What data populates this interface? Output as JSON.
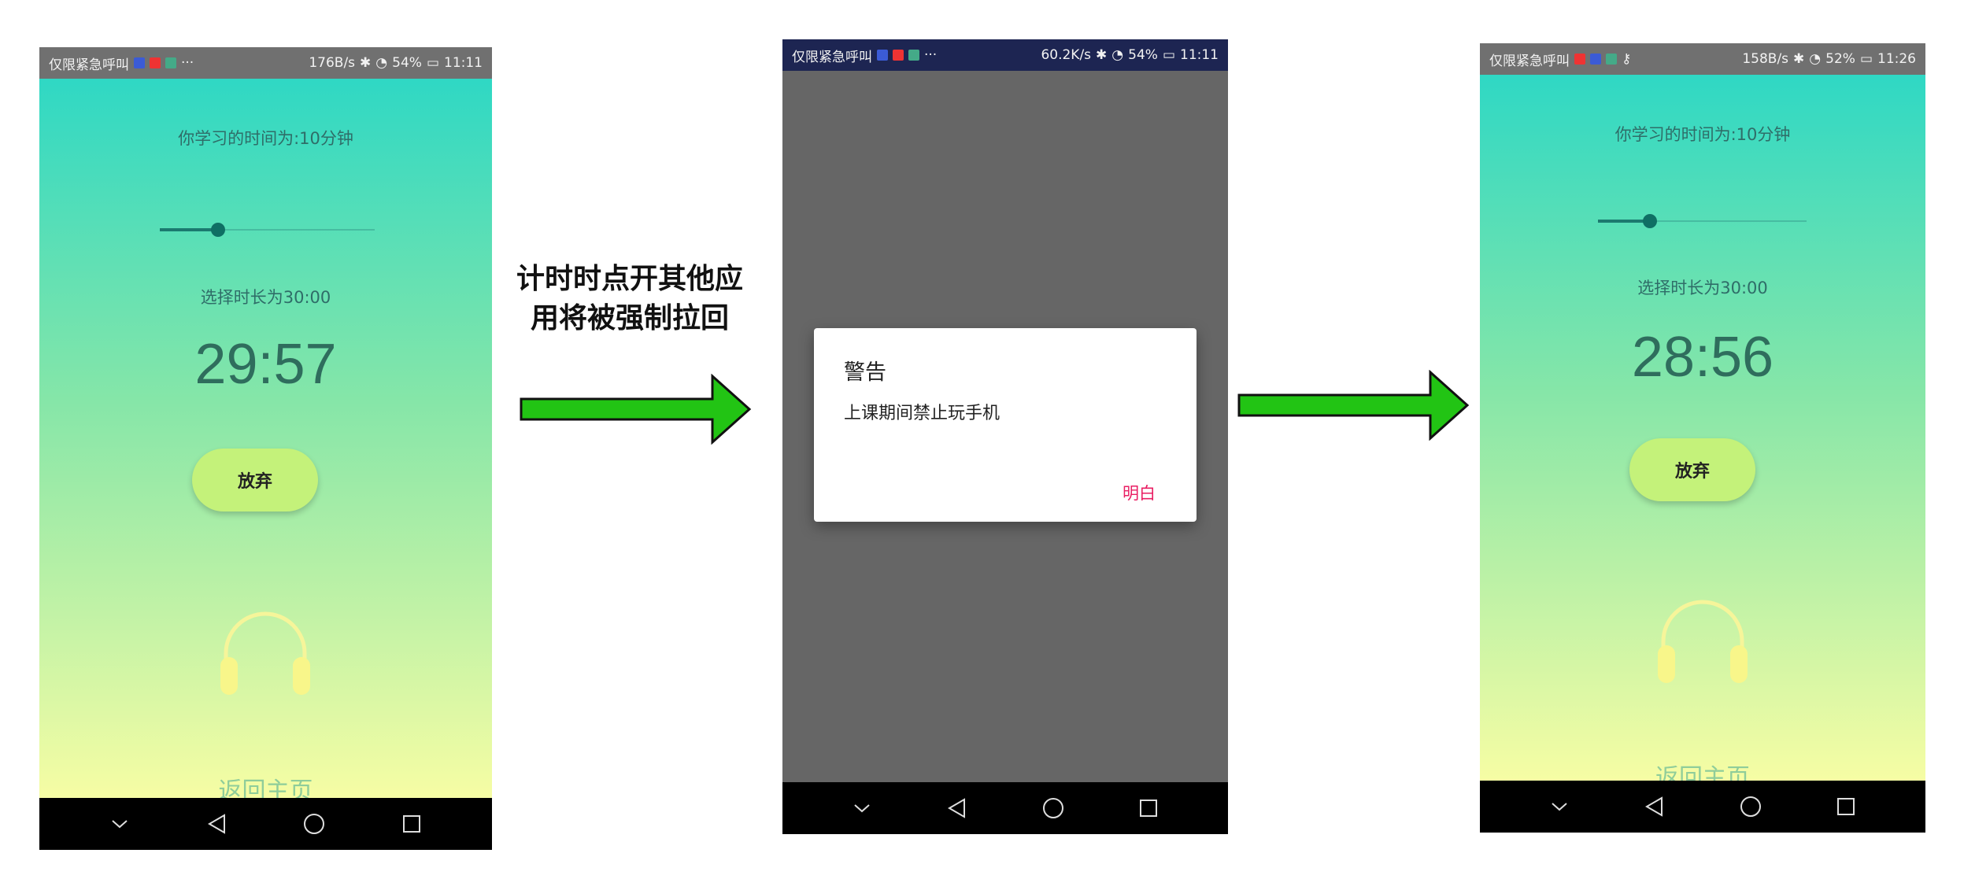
{
  "colors": {
    "statusbar_dark": "#707070",
    "statusbar_navy": "#1d2552",
    "gradient_top": "#2fd8c4",
    "gradient_bottom": "#f6fda4",
    "dialog_button": "#e91e63",
    "arrow_fill": "#22c414"
  },
  "caption": {
    "line1": "计时时点开其他应",
    "line2": "用将被强制拉回"
  },
  "phone1": {
    "status": {
      "left": "仅限紧急呼叫",
      "speed": "176B/s",
      "battery": "54%",
      "time": "11:11"
    },
    "study_time": "你学习的时间为:10分钟",
    "slider_value": 0.27,
    "duration": "选择时长为30:00",
    "timer": "29:57",
    "give_up": "放弃",
    "home_link": "返回主页"
  },
  "phone2": {
    "status": {
      "left": "仅限紧急呼叫",
      "speed": "60.2K/s",
      "battery": "54%",
      "time": "11:11"
    },
    "dialog": {
      "title": "警告",
      "message": "上课期间禁止玩手机",
      "button": "明白"
    }
  },
  "phone3": {
    "status": {
      "left": "仅限紧急呼叫",
      "speed": "158B/s",
      "battery": "52%",
      "time": "11:26"
    },
    "study_time": "你学习的时间为:10分钟",
    "slider_value": 0.25,
    "duration": "选择时长为30:00",
    "timer": "28:56",
    "give_up": "放弃",
    "home_link": "返回主页"
  },
  "icons": [
    "headphones-icon",
    "back-icon",
    "home-icon",
    "recents-icon",
    "collapse-icon",
    "wifi-icon",
    "bluetooth-icon"
  ]
}
